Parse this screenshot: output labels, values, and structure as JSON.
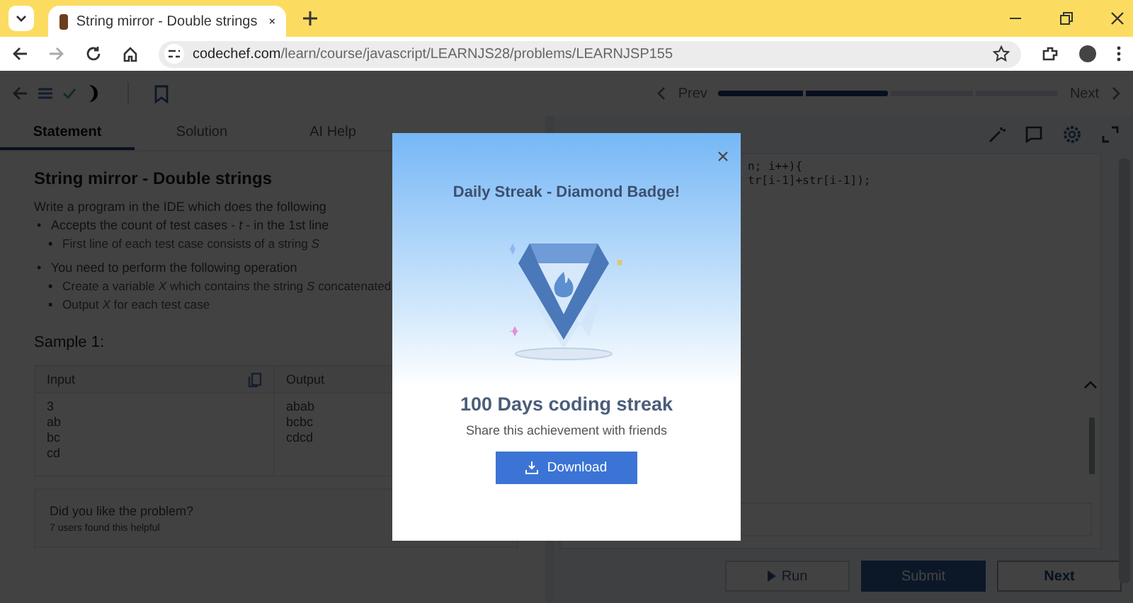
{
  "browser": {
    "tab_title": "String mirror - Double strings",
    "url_host": "codechef.com",
    "url_path": "/learn/course/javascript/LEARNJS28/problems/LEARNJSP155"
  },
  "app_header": {
    "prev": "Prev",
    "next": "Next",
    "progress": {
      "level": 0.5
    }
  },
  "tabs": [
    {
      "label": "Statement",
      "selected": true
    },
    {
      "label": "Solution",
      "selected": false
    },
    {
      "label": "AI Help",
      "selected": false
    }
  ],
  "problem": {
    "title": "String mirror - Double strings",
    "intro": "Write a program in the IDE which does the following",
    "bullets": [
      {
        "marker": "•",
        "text": "Accepts the count of test cases - *t* - in the 1st line",
        "children": [
          {
            "marker": "▪",
            "text": "First line of each test case consists of a string *S*"
          }
        ]
      },
      {
        "marker": "•",
        "text": "You need to perform the following operation",
        "children": [
          {
            "marker": "▪",
            "text": "Create a variable *X* which contains the string *S* concatenated"
          },
          {
            "marker": "▪",
            "text": "Output *X* for each test case"
          }
        ]
      }
    ]
  },
  "sample": {
    "heading": "Sample 1:",
    "columns": [
      "Input",
      "Output"
    ],
    "input": [
      "3",
      "ab",
      "bc",
      "cd"
    ],
    "output": [
      "abab",
      "bcbc",
      "cdcd"
    ]
  },
  "feedback": {
    "question": "Did you like the problem?",
    "helpful": "7 users found this helpful"
  },
  "editor": {
    "code_lines": [
      "n; i++){",
      "tr[i-1]+str[i-1]);"
    ]
  },
  "actions": [
    {
      "label": "Run",
      "kind": "run"
    },
    {
      "label": "Submit",
      "kind": "submit"
    },
    {
      "label": "Next",
      "kind": "next"
    }
  ],
  "modal": {
    "title": "Daily Streak - Diamond Badge!",
    "headline": "100 Days coding streak",
    "description": "Share this achievement with friends",
    "button": "Download"
  }
}
